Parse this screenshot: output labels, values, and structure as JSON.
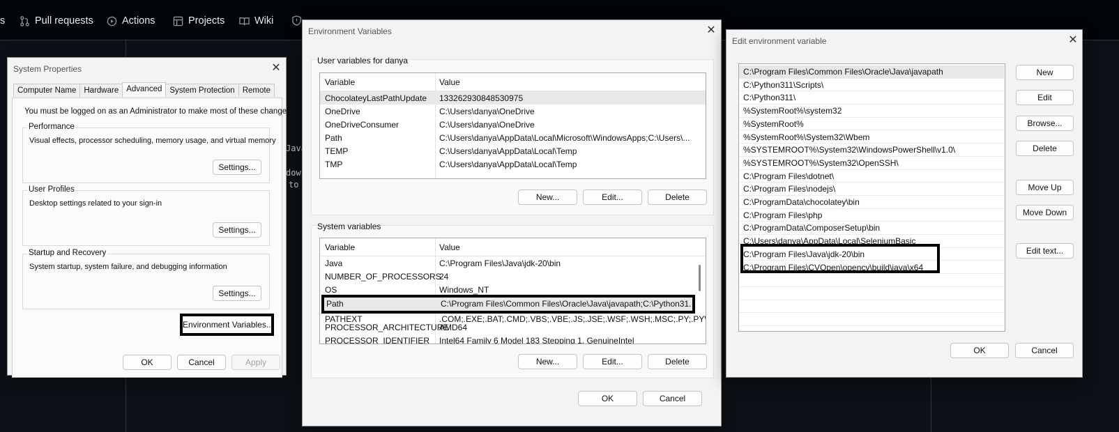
{
  "github": {
    "tabs": [
      {
        "label": "s",
        "icon": "none"
      },
      {
        "label": "Pull requests",
        "icon": "pull-request-icon"
      },
      {
        "label": "Actions",
        "icon": "play-icon"
      },
      {
        "label": "Projects",
        "icon": "table-icon"
      },
      {
        "label": "Wiki",
        "icon": "book-icon"
      }
    ],
    "code_lines": [
      "Java",
      "dows",
      "to"
    ]
  },
  "system_properties": {
    "title": "System Properties",
    "tabs": [
      "Computer Name",
      "Hardware",
      "Advanced",
      "System Protection",
      "Remote"
    ],
    "active_tab": "Advanced",
    "admin_note": "You must be logged on as an Administrator to make most of these changes.",
    "performance": {
      "title": "Performance",
      "desc": "Visual effects, processor scheduling, memory usage, and virtual memory",
      "button": "Settings..."
    },
    "user_profiles": {
      "title": "User Profiles",
      "desc": "Desktop settings related to your sign-in",
      "button": "Settings..."
    },
    "startup": {
      "title": "Startup and Recovery",
      "desc": "System startup, system failure, and debugging information",
      "button": "Settings..."
    },
    "env_button": "Environment Variables...",
    "ok": "OK",
    "cancel": "Cancel",
    "apply": "Apply"
  },
  "env_vars": {
    "title": "Environment Variables",
    "user_section_title": "User variables for danya",
    "col_variable": "Variable",
    "col_value": "Value",
    "user_rows": [
      {
        "variable": "ChocolateyLastPathUpdate",
        "value": "133262930848530975"
      },
      {
        "variable": "OneDrive",
        "value": "C:\\Users\\danya\\OneDrive"
      },
      {
        "variable": "OneDriveConsumer",
        "value": "C:\\Users\\danya\\OneDrive"
      },
      {
        "variable": "Path",
        "value": "C:\\Users\\danya\\AppData\\Local\\Microsoft\\WindowsApps;C:\\Users\\..."
      },
      {
        "variable": "TEMP",
        "value": "C:\\Users\\danya\\AppData\\Local\\Temp"
      },
      {
        "variable": "TMP",
        "value": "C:\\Users\\danya\\AppData\\Local\\Temp"
      }
    ],
    "system_section_title": "System variables",
    "system_rows": [
      {
        "variable": "Java",
        "value": "C:\\Program Files\\Java\\jdk-20\\bin"
      },
      {
        "variable": "NUMBER_OF_PROCESSORS",
        "value": "24"
      },
      {
        "variable": "OS",
        "value": "Windows_NT"
      },
      {
        "variable": "Path",
        "value": "C:\\Program Files\\Common Files\\Oracle\\Java\\javapath;C:\\Python31..."
      },
      {
        "variable": "PATHEXT",
        "value": ".COM;.EXE;.BAT;.CMD;.VBS;.VBE;.JS;.JSE;.WSF;.WSH;.MSC;.PY;.PYW"
      },
      {
        "variable": "PROCESSOR_ARCHITECTURE",
        "value": "AMD64"
      },
      {
        "variable": "PROCESSOR_IDENTIFIER",
        "value": "Intel64 Family 6 Model 183 Stepping 1, GenuineIntel"
      }
    ],
    "new": "New...",
    "edit": "Edit...",
    "delete": "Delete",
    "ok": "OK",
    "cancel": "Cancel"
  },
  "edit_env": {
    "title": "Edit environment variable",
    "paths": [
      "C:\\Program Files\\Common Files\\Oracle\\Java\\javapath",
      "C:\\Python311\\Scripts\\",
      "C:\\Python311\\",
      "%SystemRoot%\\system32",
      "%SystemRoot%",
      "%SystemRoot%\\System32\\Wbem",
      "%SYSTEMROOT%\\System32\\WindowsPowerShell\\v1.0\\",
      "%SYSTEMROOT%\\System32\\OpenSSH\\",
      "C:\\Program Files\\dotnet\\",
      "C:\\Program Files\\nodejs\\",
      "C:\\ProgramData\\chocolatey\\bin",
      "C:\\Program Files\\php",
      "C:\\ProgramData\\ComposerSetup\\bin",
      "C:\\Users\\danya\\AppData\\Local\\SeleniumBasic",
      "C:\\Program Files\\Java\\jdk-20\\bin",
      "C:\\Program Files\\CVOpen\\opencv\\build\\java\\x64"
    ],
    "buttons": {
      "new": "New",
      "edit": "Edit",
      "browse": "Browse...",
      "delete": "Delete",
      "move_up": "Move Up",
      "move_down": "Move Down",
      "edit_text": "Edit text..."
    },
    "ok": "OK",
    "cancel": "Cancel"
  }
}
